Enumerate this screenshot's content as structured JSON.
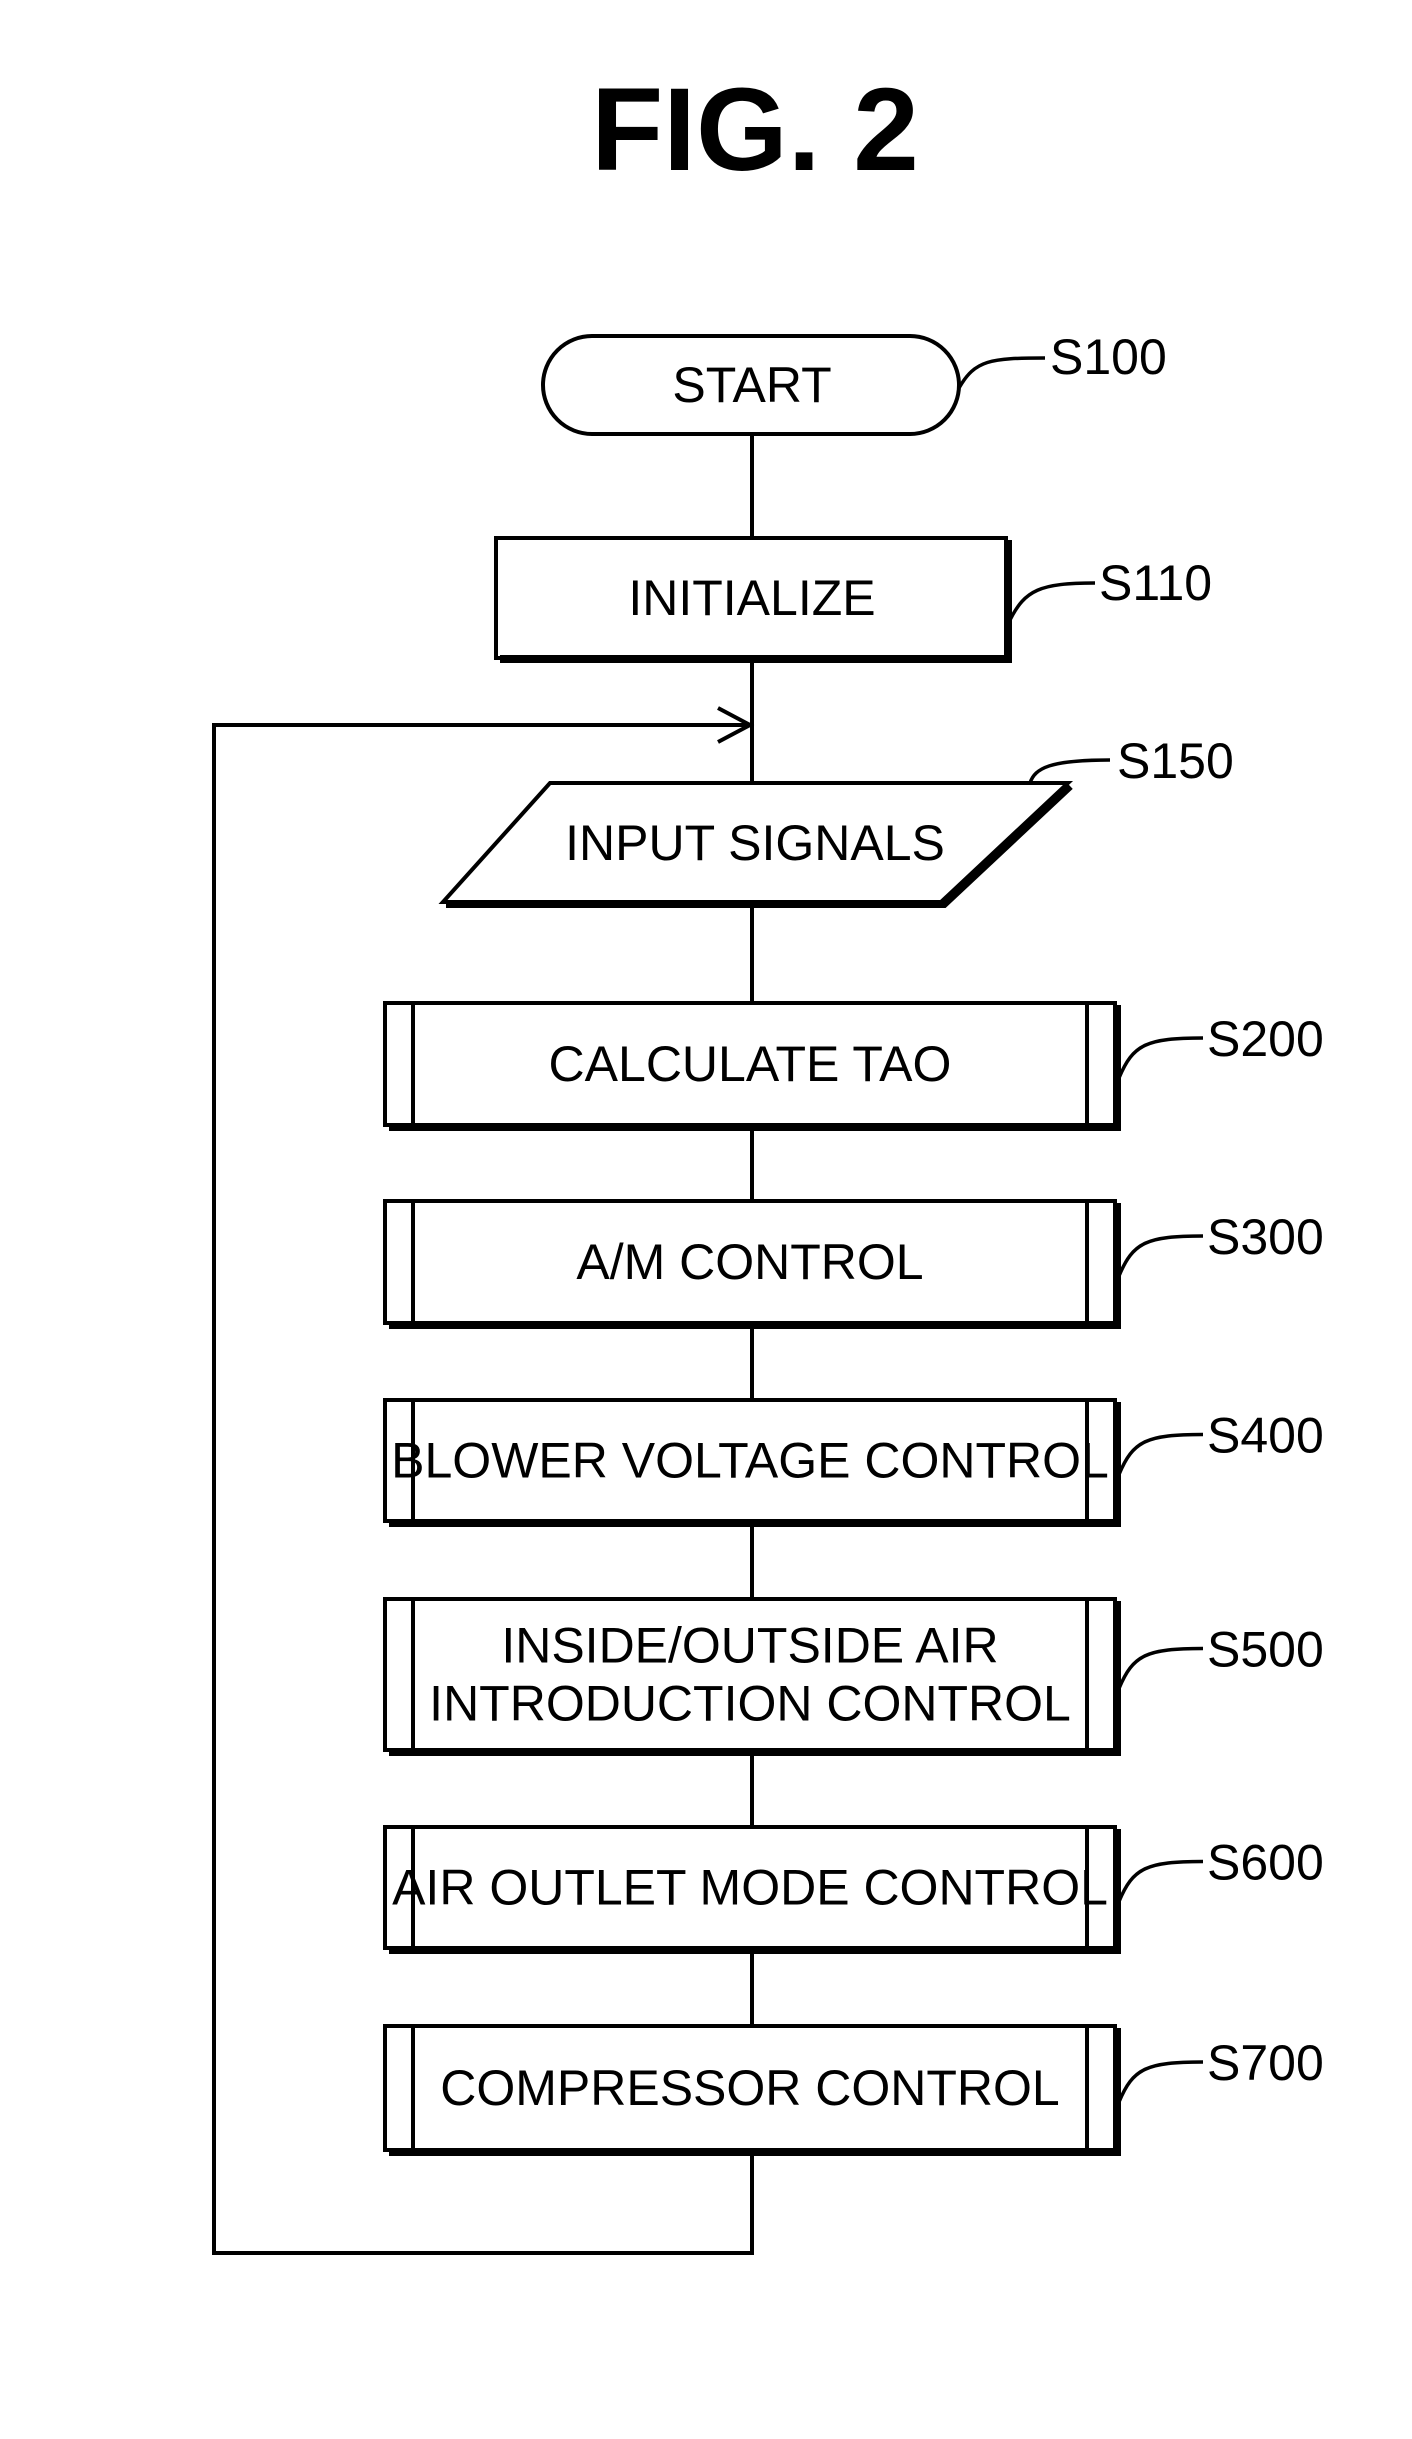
{
  "figure": {
    "title": "FIG. 2",
    "start": {
      "label": "START",
      "step": "S100"
    },
    "initialize": {
      "label": "INITIALIZE",
      "step": "S110"
    },
    "input": {
      "label": "INPUT SIGNALS",
      "step": "S150"
    },
    "subroutines": [
      {
        "lines": [
          "CALCULATE TAO"
        ],
        "step": "S200"
      },
      {
        "lines": [
          "A/M CONTROL"
        ],
        "step": "S300"
      },
      {
        "lines": [
          "BLOWER VOLTAGE CONTROL"
        ],
        "step": "S400"
      },
      {
        "lines": [
          "INSIDE/OUTSIDE AIR",
          "INTRODUCTION CONTROL"
        ],
        "step": "S500"
      },
      {
        "lines": [
          "AIR OUTLET MODE CONTROL"
        ],
        "step": "S600"
      },
      {
        "lines": [
          "COMPRESSOR CONTROL"
        ],
        "step": "S700"
      }
    ],
    "loop": {
      "description": "Return from S700 to before S150"
    }
  }
}
